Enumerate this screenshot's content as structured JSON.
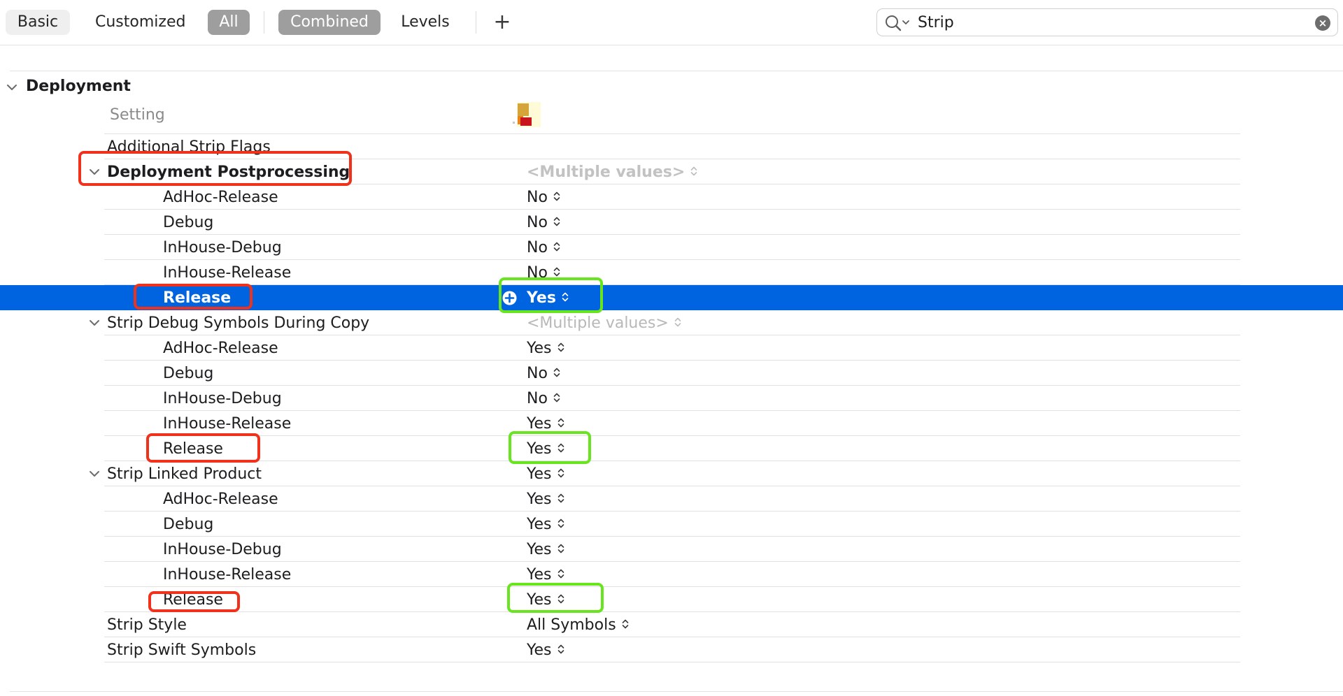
{
  "toolbar": {
    "tabs": [
      "Basic",
      "Customized",
      "All",
      "Combined",
      "Levels"
    ],
    "add_label": "+",
    "search_value": "Strip"
  },
  "section": {
    "title": "Deployment",
    "column_header": "Setting"
  },
  "rows": [
    {
      "name": "Additional Strip Flags",
      "value": "",
      "level": 1
    },
    {
      "name": "Deployment Postprocessing",
      "value": "<Multiple values>",
      "level": 1,
      "expanded": true
    },
    {
      "name": "AdHoc-Release",
      "value": "No",
      "level": 2
    },
    {
      "name": "Debug",
      "value": "No",
      "level": 2
    },
    {
      "name": "InHouse-Debug",
      "value": "No",
      "level": 2
    },
    {
      "name": "InHouse-Release",
      "value": "No",
      "level": 2
    },
    {
      "name": "Release",
      "value": "Yes",
      "level": 2,
      "selected": true
    },
    {
      "name": "Strip Debug Symbols During Copy",
      "value": "<Multiple values>",
      "level": 1,
      "expanded": true
    },
    {
      "name": "AdHoc-Release",
      "value": "Yes",
      "level": 2
    },
    {
      "name": "Debug",
      "value": "No",
      "level": 2
    },
    {
      "name": "InHouse-Debug",
      "value": "No",
      "level": 2
    },
    {
      "name": "InHouse-Release",
      "value": "Yes",
      "level": 2
    },
    {
      "name": "Release",
      "value": "Yes",
      "level": 2
    },
    {
      "name": "Strip Linked Product",
      "value": "Yes",
      "level": 1,
      "expanded": true
    },
    {
      "name": "AdHoc-Release",
      "value": "Yes",
      "level": 2
    },
    {
      "name": "Debug",
      "value": "Yes",
      "level": 2
    },
    {
      "name": "InHouse-Debug",
      "value": "Yes",
      "level": 2
    },
    {
      "name": "InHouse-Release",
      "value": "Yes",
      "level": 2
    },
    {
      "name": "Release",
      "value": "Yes",
      "level": 2
    },
    {
      "name": "Strip Style",
      "value": "All Symbols",
      "level": 1
    },
    {
      "name": "Strip Swift Symbols",
      "value": "Yes",
      "level": 1
    }
  ],
  "colors": {
    "selection": "#0064e0",
    "annotation_red": "#f0321c",
    "annotation_green": "#68e51f",
    "segment_selected": "#9e9e9e"
  }
}
